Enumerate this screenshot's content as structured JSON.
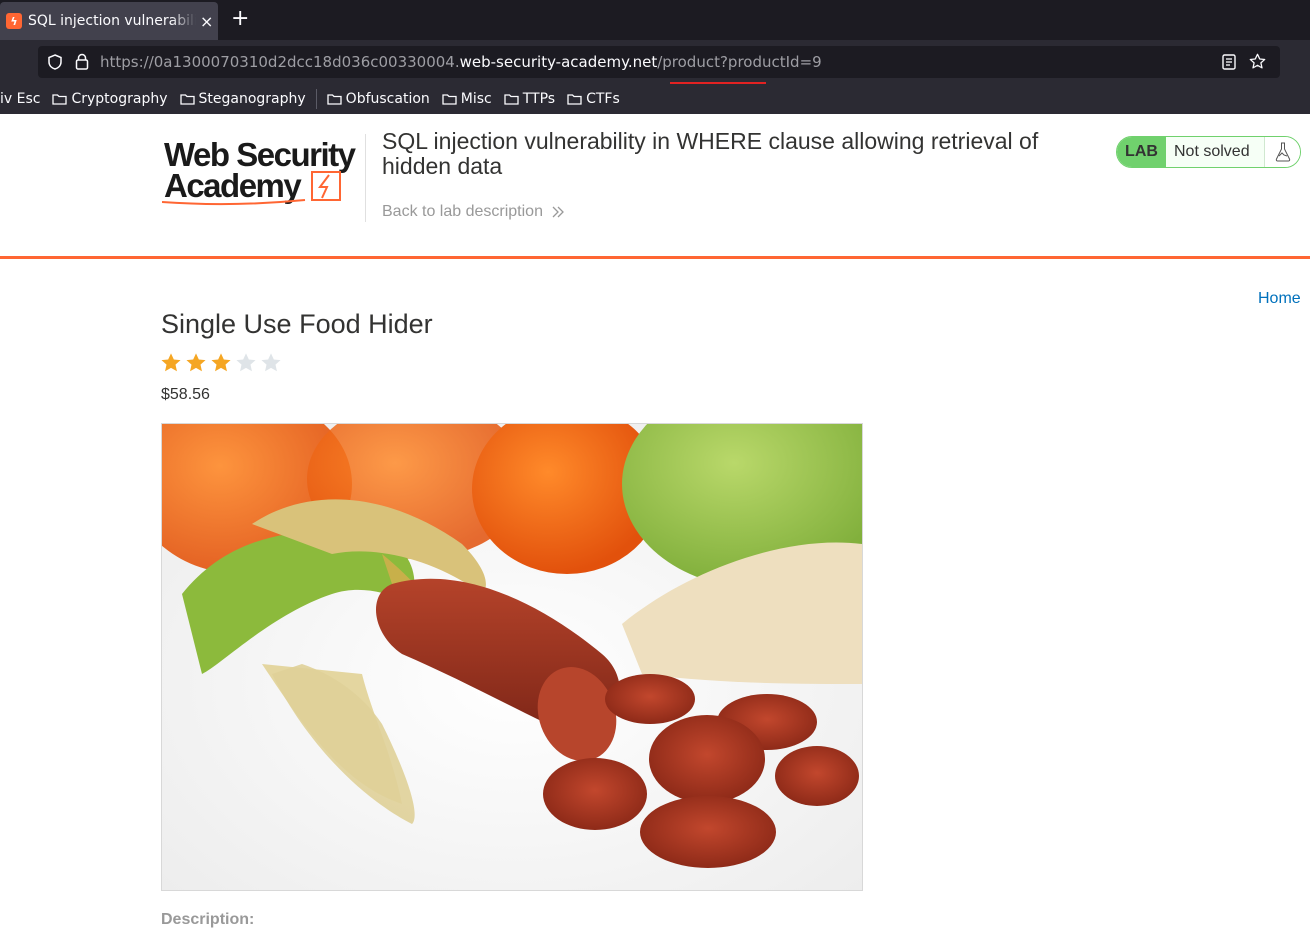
{
  "browser": {
    "tab_title": "SQL injection vulnerability in WHERE clause allowing retrieval of hidden data",
    "tab_close": "×",
    "new_tab": "+",
    "url_prefix": "https://0a1300070310d2dcc18d036c00330004.",
    "url_domain": "web-security-academy.net",
    "url_path": "/product?productId=9",
    "bookmarks": [
      "iv Esc",
      "Cryptography",
      "Steganography",
      "Obfuscation",
      "Misc",
      "TTPs",
      "CTFs"
    ]
  },
  "header": {
    "logo_line1": "Web Security",
    "logo_line2": "Academy",
    "lab_title": "SQL injection vulnerability in WHERE clause allowing retrieval of hidden data",
    "back_link": "Back to lab description",
    "lab_tag": "LAB",
    "lab_status": "Not solved"
  },
  "nav": {
    "home": "Home"
  },
  "product": {
    "title": "Single Use Food Hider",
    "rating": 3,
    "rating_max": 5,
    "price": "$58.56",
    "description_label": "Description:"
  },
  "colors": {
    "accent": "#ff6633",
    "lab_green": "#70d16d",
    "link_blue": "#0071bc",
    "star_filled": "#f5a623",
    "star_empty": "#dfe4e8"
  }
}
